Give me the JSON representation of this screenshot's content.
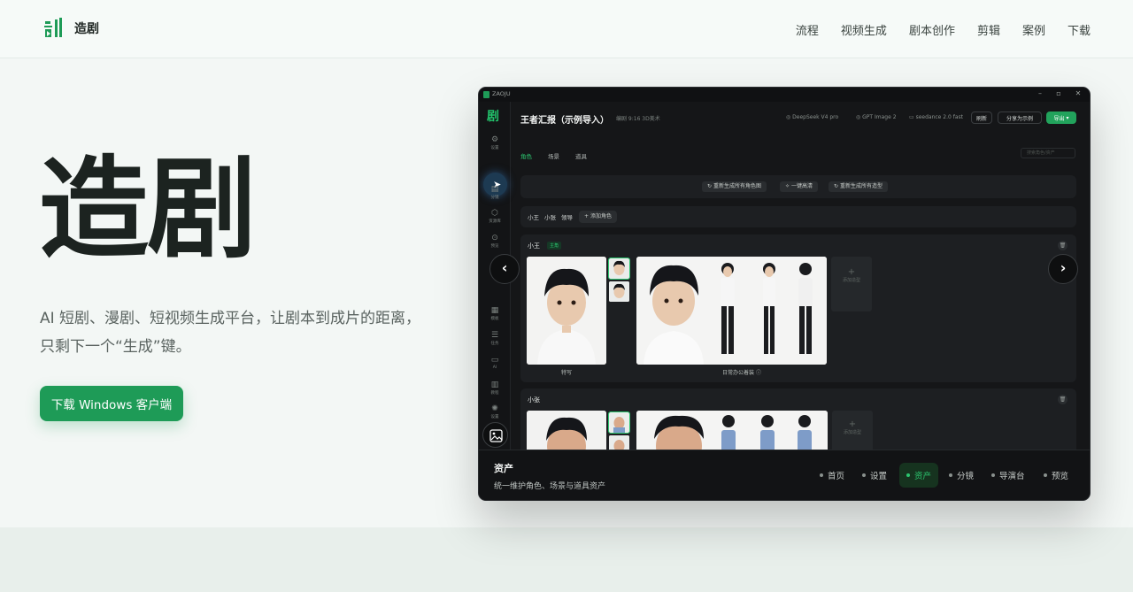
{
  "brand": {
    "name": "造剧"
  },
  "nav": [
    "流程",
    "视频生成",
    "剧本创作",
    "剪辑",
    "案例",
    "下载"
  ],
  "hero": {
    "title": "造剧",
    "subtitle": "AI 短剧、漫剧、短视频生成平台，让剧本到成片的距离，只剩下一个“生成”键。",
    "cta": "下载 Windows 客户端"
  },
  "app": {
    "window_title": "ZAOJU",
    "project_title": "王者汇报（示例导入）",
    "meta": "编剧  9:16  3D美术",
    "models": [
      "DeepSeek V4 pro",
      "GPT Image 2",
      "seedance 2.0 fast"
    ],
    "header_buttons": [
      "刷新",
      "分享为示例",
      "导出"
    ],
    "tabs": [
      "角色",
      "场景",
      "道具"
    ],
    "search_placeholder": "搜索角色/资产",
    "bulk_actions": [
      "重新生成所有角色图",
      "一键高清",
      "重新生成所有造型"
    ],
    "characters_chips": [
      "小王",
      "小张",
      "领导"
    ],
    "add_character": "添加角色",
    "sidebar": [
      {
        "icon": "gear-icon",
        "glyph": "⚙",
        "label": "设置"
      },
      {
        "icon": "film-icon",
        "glyph": "▤",
        "label": "分镜"
      },
      {
        "icon": "box-icon",
        "glyph": "⬡",
        "label": "资源库"
      },
      {
        "icon": "play-icon",
        "glyph": "⊙",
        "label": "预览"
      },
      {
        "icon": "grid-icon",
        "glyph": "▦",
        "label": "模板"
      },
      {
        "icon": "list-icon",
        "glyph": "☰",
        "label": "任务"
      },
      {
        "icon": "monitor-icon",
        "glyph": "▭",
        "label": "AI"
      },
      {
        "icon": "book-icon",
        "glyph": "▥",
        "label": "教程"
      },
      {
        "icon": "settings-icon",
        "glyph": "✺",
        "label": "设置"
      }
    ],
    "card1": {
      "name": "小王",
      "badge": "主角",
      "caption_left": "特写",
      "caption_right": "日常办公着装"
    },
    "card2": {
      "name": "小张"
    },
    "add_outfit": "添加造型",
    "footer": {
      "title": "资产",
      "desc": "统一维护角色、场景与道具资产",
      "items": [
        "首页",
        "设置",
        "资产",
        "分镜",
        "导演台",
        "预览"
      ]
    }
  }
}
